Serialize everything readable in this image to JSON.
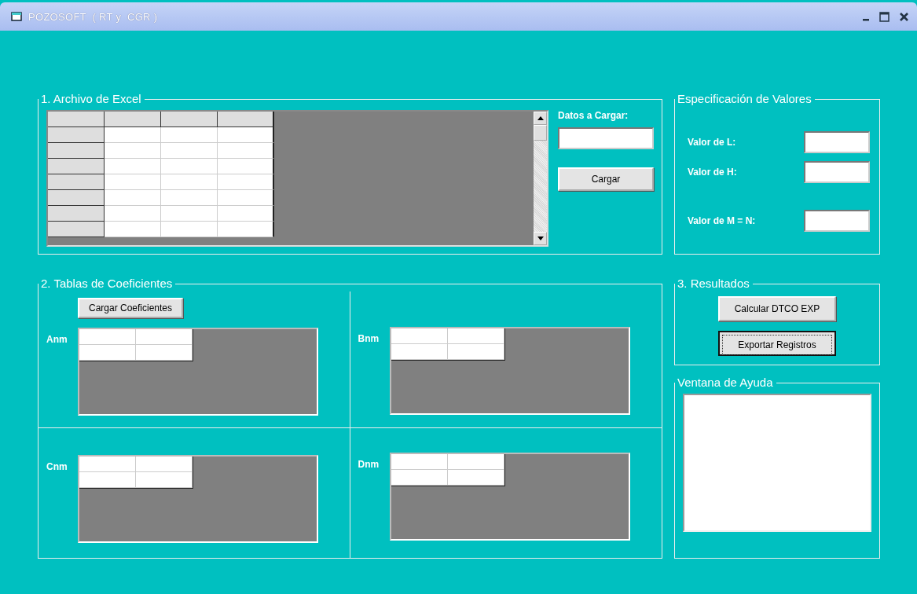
{
  "window": {
    "title": "POZOSOFT  ( RT y  CGR )"
  },
  "excel": {
    "legend": "1. Archivo de Excel",
    "data_label": "Datos a Cargar:",
    "load_button": "Cargar"
  },
  "values": {
    "legend": "Especificación de Valores",
    "fields": [
      {
        "label": "Valor de L:"
      },
      {
        "label": "Valor de H:"
      },
      {
        "label": "Valor de M = N:"
      }
    ]
  },
  "coefficients": {
    "legend": "2. Tablas de Coeficientes",
    "load_button": "Cargar Coeficientes",
    "tables": [
      {
        "label": "Anm"
      },
      {
        "label": "Bnm"
      },
      {
        "label": "Cnm"
      },
      {
        "label": "Dnm"
      }
    ]
  },
  "results": {
    "legend": "3. Resultados",
    "buttons": [
      {
        "label": "Calcular DTCO EXP",
        "focused": false
      },
      {
        "label": "Exportar Registros",
        "focused": true
      }
    ]
  },
  "help": {
    "legend": "Ventana de Ayuda"
  }
}
